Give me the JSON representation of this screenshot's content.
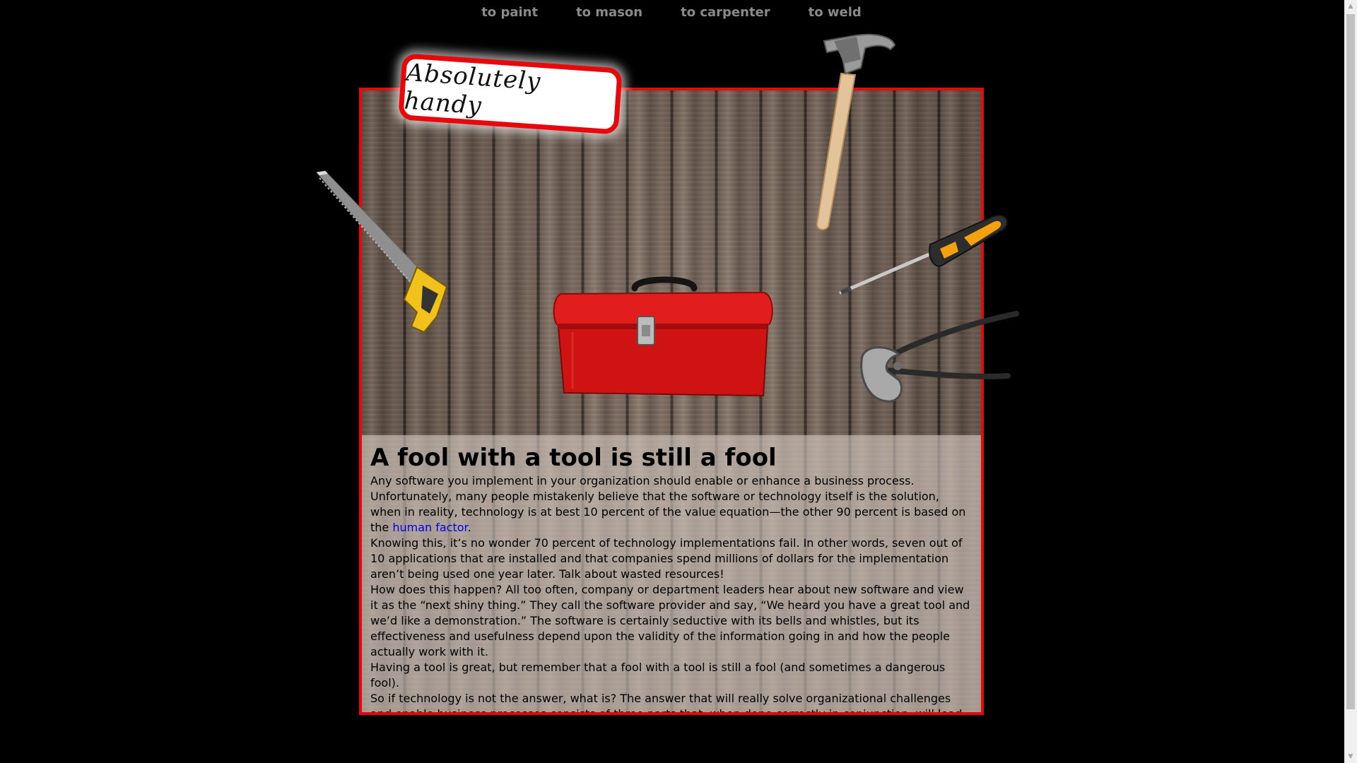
{
  "nav": {
    "items": [
      {
        "label": "to paint"
      },
      {
        "label": "to mason"
      },
      {
        "label": "to carpenter"
      },
      {
        "label": "to weld"
      }
    ]
  },
  "logo": {
    "text": "Absolutely handy"
  },
  "article": {
    "title": "A fool with a tool is still a fool",
    "p1": "Any software you implement in your organization should enable or enhance a business process.",
    "p2_before": "Unfortunately, many people mistakenly believe that the software or technology itself is the solution, when in reality, technology is at best 10 percent of the value equation—the other 90 percent is based on the ",
    "p2_link": "human factor",
    "p2_after": ".",
    "p3": "Knowing this, it’s no wonder 70 percent of technology implementations fail. In other words, seven out of 10 applications that are installed and that companies spend millions of dollars for the implementation aren’t being used one year later. Talk about wasted resources!",
    "p4": "How does this happen? All too often, company or department leaders hear about new software and view it as the “next shiny thing.” They call the software provider and say, “We heard you have a great tool and we’d like a demonstration.” The software is certainly seductive with its bells and whistles, but its effectiveness and usefulness depend upon the validity of the information going in and how the people actually work with it.",
    "p5": "Having a tool is great, but remember that a fool with a tool is still a fool (and sometimes a dangerous fool).",
    "p6": "So if technology is not the answer, what is? The answer that will really solve organizational challenges and enable business processes consists of three parts that, when done correctly in conjunction, will lead to long lasting results."
  },
  "colors": {
    "frame_border": "#e8070b",
    "nav_text": "#8a8a8a",
    "link": "#0000ee",
    "background": "#000000"
  },
  "icons": [
    "saw-icon",
    "hammer-icon",
    "screwdriver-icon",
    "toolbox-icon",
    "pincers-icon"
  ]
}
